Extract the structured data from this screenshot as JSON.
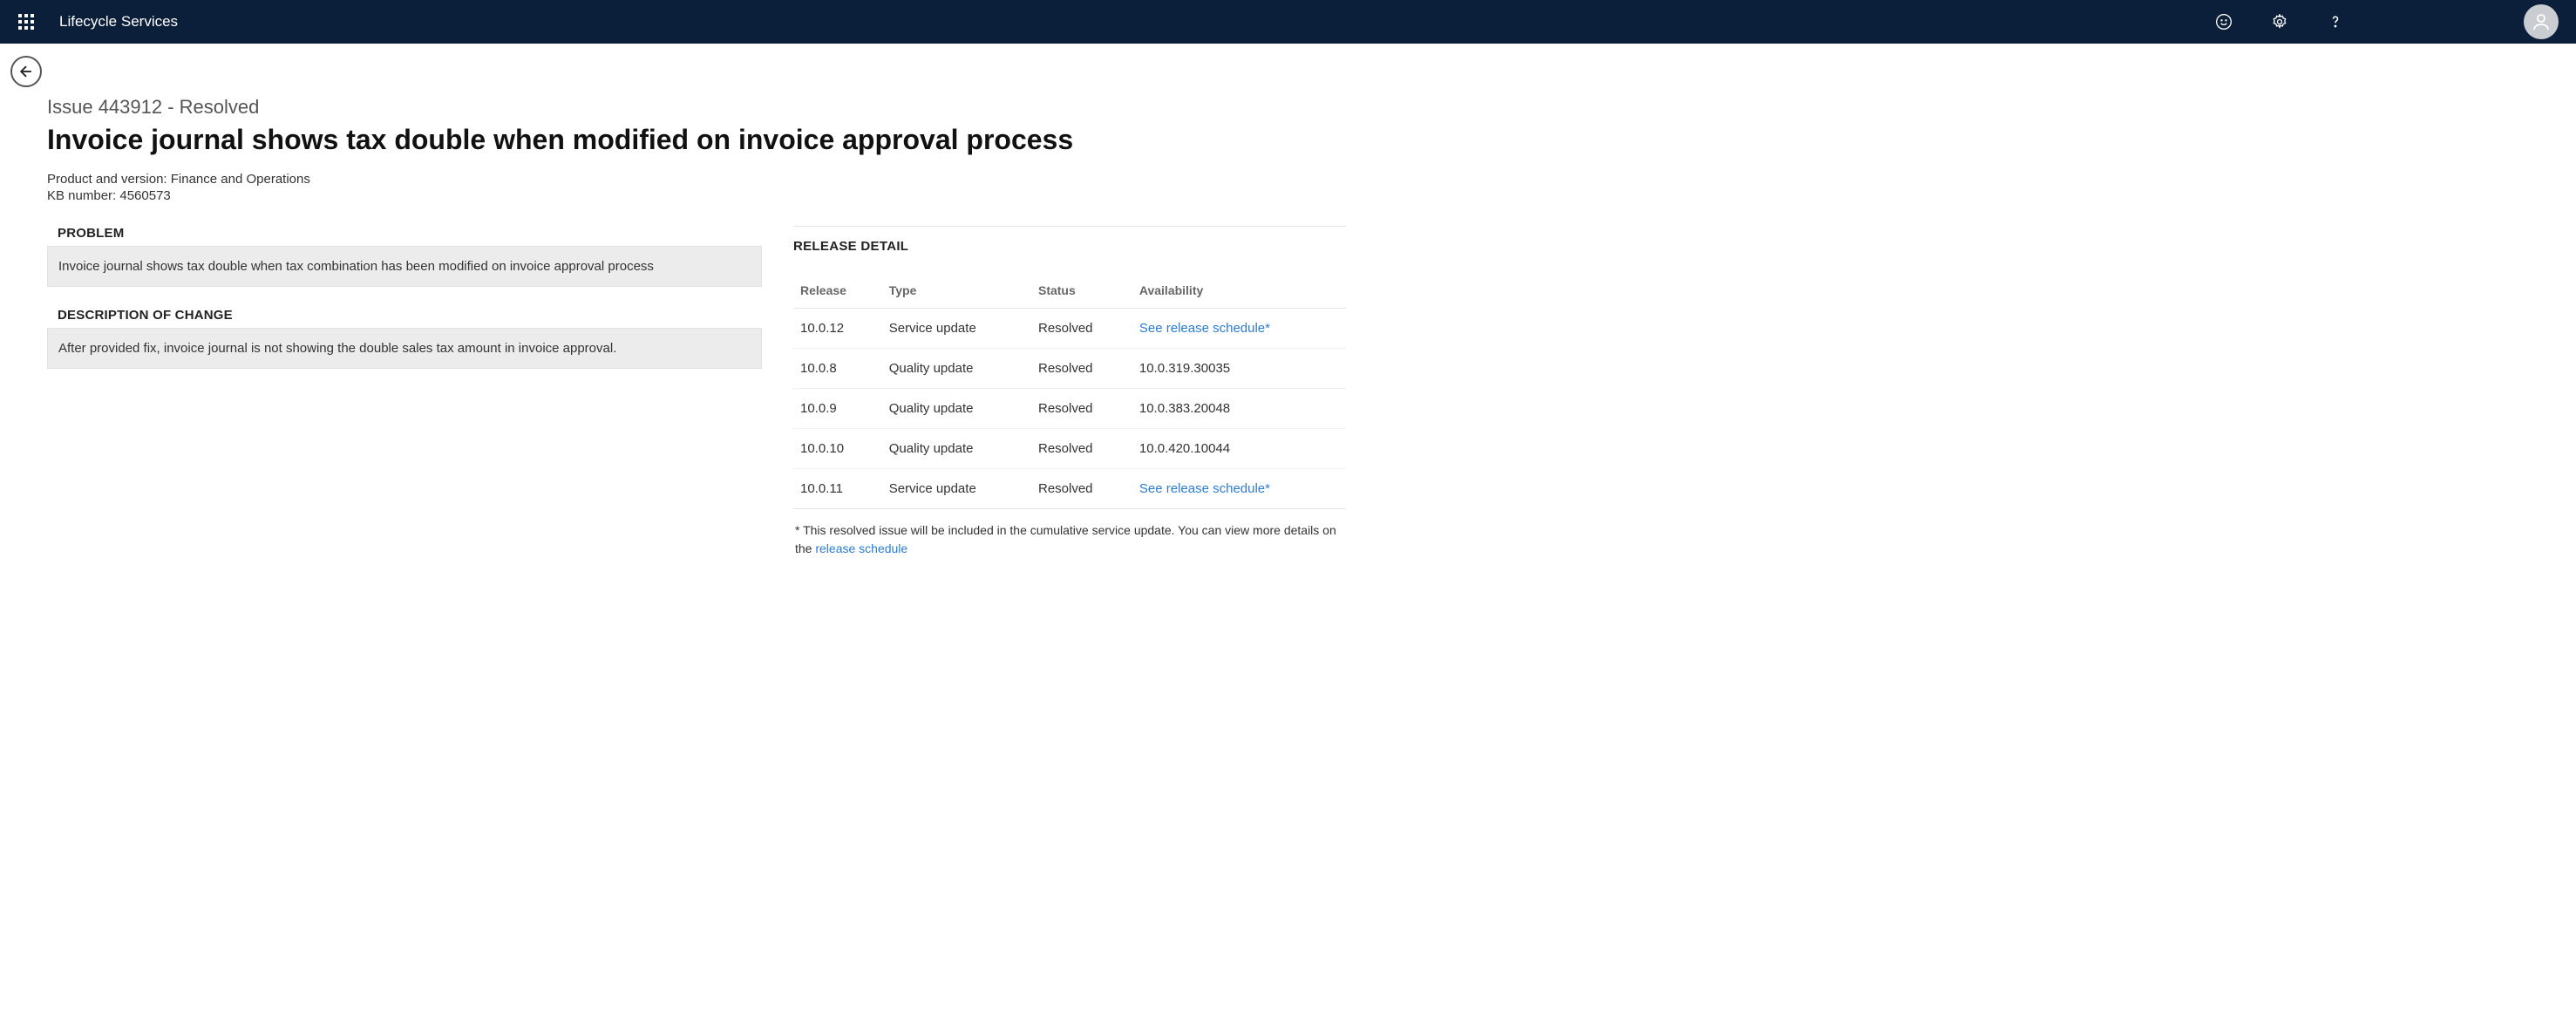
{
  "header": {
    "app_title": "Lifecycle Services"
  },
  "issue": {
    "id_line": "Issue 443912 - Resolved",
    "title": "Invoice journal shows tax double when modified on invoice approval process",
    "product_line": "Product and version: Finance and Operations",
    "kb_line": "KB number: 4560573"
  },
  "sections": {
    "problem_heading": "PROBLEM",
    "problem_text": "Invoice journal shows tax double when tax combination has been modified on invoice approval process",
    "change_heading": "DESCRIPTION OF CHANGE",
    "change_text": "After provided fix, invoice journal is not showing the double sales tax amount in invoice approval."
  },
  "release_detail": {
    "heading": "RELEASE DETAIL",
    "columns": {
      "release": "Release",
      "type": "Type",
      "status": "Status",
      "availability": "Availability"
    },
    "rows": [
      {
        "release": "10.0.12",
        "type": "Service update",
        "status": "Resolved",
        "availability": "See release schedule*",
        "is_link": true
      },
      {
        "release": "10.0.8",
        "type": "Quality update",
        "status": "Resolved",
        "availability": "10.0.319.30035",
        "is_link": false
      },
      {
        "release": "10.0.9",
        "type": "Quality update",
        "status": "Resolved",
        "availability": "10.0.383.20048",
        "is_link": false
      },
      {
        "release": "10.0.10",
        "type": "Quality update",
        "status": "Resolved",
        "availability": "10.0.420.10044",
        "is_link": false
      },
      {
        "release": "10.0.11",
        "type": "Service update",
        "status": "Resolved",
        "availability": "See release schedule*",
        "is_link": true
      }
    ],
    "footnote_pre": "* This resolved issue will be included in the cumulative service update. You can view more details on the ",
    "footnote_link": "release schedule"
  }
}
